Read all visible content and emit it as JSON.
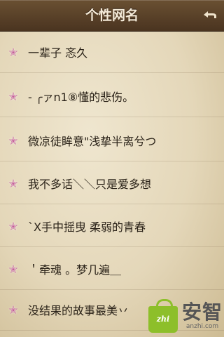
{
  "header": {
    "title": "个性网名",
    "back_icon": "back-arrow-icon"
  },
  "list": {
    "items": [
      {
        "label": "一辈子 忞久",
        "icon": "star-icon"
      },
      {
        "label": "- ╭ァn1⑧懂的悲伤。",
        "icon": "star-icon"
      },
      {
        "label": "微凉徒眸意\"浅挚半离兮つ",
        "icon": "star-icon"
      },
      {
        "label": "我不多话＼＼只是爱多想",
        "icon": "star-icon"
      },
      {
        "label": "`X手中摇曳 柔弱的青春",
        "icon": "star-icon"
      },
      {
        "label": "＇牵魂 。梦几遍＿",
        "icon": "star-icon"
      },
      {
        "label": "没结果的故事最美丷",
        "icon": "star-icon"
      }
    ]
  },
  "watermark": {
    "brand": "安智",
    "url": "anzhi.com",
    "bag_text": "zhi"
  },
  "colors": {
    "titlebar": "#5a4028",
    "icon": "#c5609a",
    "text": "#2a2218"
  }
}
